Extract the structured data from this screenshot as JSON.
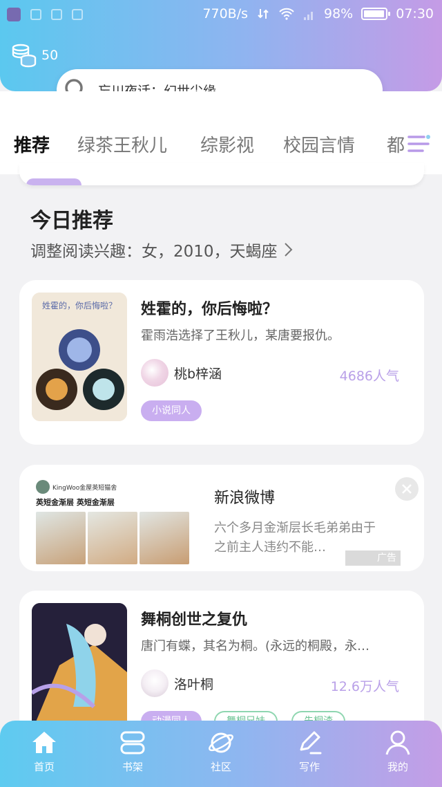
{
  "status_bar": {
    "speed": "770B/s",
    "battery": "98%",
    "battery_level": 0.98,
    "time": "07:30"
  },
  "coins": {
    "count": "50",
    "icon": "coins-icon"
  },
  "search": {
    "placeholder": "忘川夜话：幻世尘缘",
    "icon": "search-icon"
  },
  "tabs": [
    {
      "label": "推荐",
      "active": true
    },
    {
      "label": "绿茶王秋儿"
    },
    {
      "label": "综影视"
    },
    {
      "label": "校园言情"
    },
    {
      "label": "都"
    }
  ],
  "section": {
    "title": "今日推荐",
    "subtitle": "调整阅读兴趣：女，2010，天蝎座"
  },
  "books": [
    {
      "title": "姓霍的，你后悔啦？",
      "desc": "霍雨浩选择了王秋儿，某唐要报仇。",
      "author": "桃b梓涵",
      "popularity": "4686人气",
      "cover_text": "姓霍的，你后悔啦？",
      "tags": [
        "小说同人"
      ]
    },
    {
      "title": "舞桐创世之复仇",
      "desc": "唐门有蝶，其名为桐。(永远的桐殿，永…",
      "author": "洛叶桐",
      "popularity": "12.6万人气",
      "tags": [
        "动漫同人",
        "舞桐兄妹",
        "先桐渣"
      ]
    }
  ],
  "ad": {
    "title": "新浪微博",
    "desc": "六个多月金渐层长毛弟弟由于之前主人违约不能…",
    "label": "广告",
    "img_account": "KingWoo金屋英短猫舍",
    "img_caption": "英短金渐层 英短金渐层"
  },
  "bottom_nav": [
    {
      "label": "首页",
      "icon": "home-icon"
    },
    {
      "label": "书架",
      "icon": "bookshelf-icon"
    },
    {
      "label": "社区",
      "icon": "planet-icon"
    },
    {
      "label": "写作",
      "icon": "pen-icon"
    },
    {
      "label": "我的",
      "icon": "user-icon"
    }
  ],
  "colors": {
    "accent": "#b89ae8",
    "gradient_start": "#5bc8ef",
    "gradient_end": "#c59be6"
  }
}
